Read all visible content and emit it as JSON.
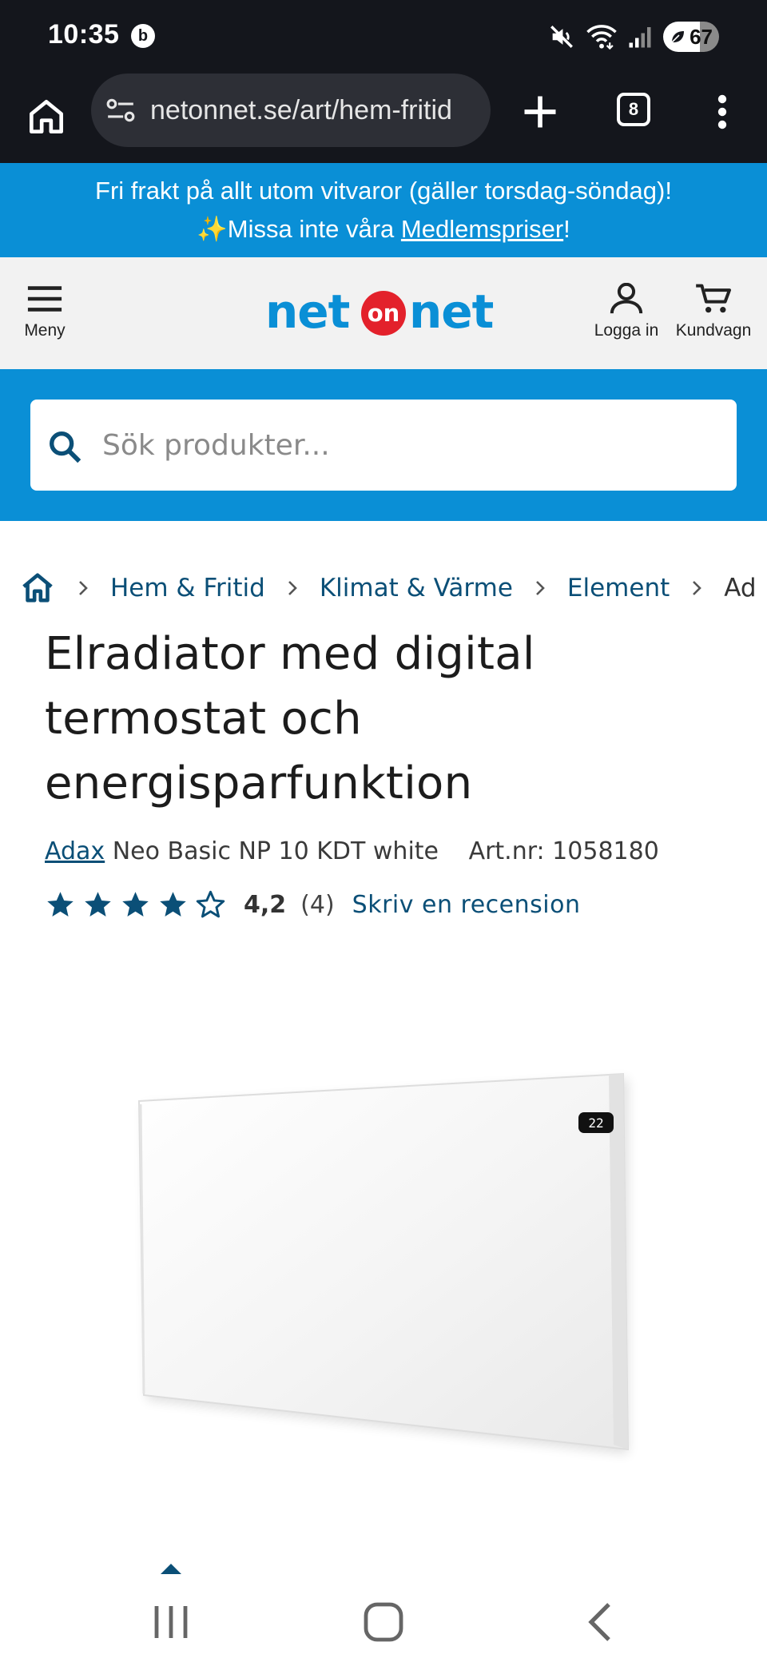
{
  "status_bar": {
    "time": "10:35",
    "notification_badge": "b",
    "battery": "67",
    "icons": [
      "mute-icon",
      "wifi-icon",
      "signal-icon",
      "battery-icon"
    ]
  },
  "browser": {
    "url": "netonnet.se/art/hem-fritid",
    "tab_count": "8",
    "icons": [
      "home-icon",
      "site-settings-icon",
      "new-tab-icon",
      "tab-switcher-icon",
      "more-icon"
    ]
  },
  "promo": {
    "line1": "Fri frakt på allt utom vitvaror (gäller torsdag-söndag)!",
    "line2_prefix": "✨Missa inte våra ",
    "line2_link": "Medlemspriser",
    "line2_suffix": "!"
  },
  "header": {
    "menu_label": "Meny",
    "logo_text": {
      "left": "net",
      "middle": "on",
      "right": "net"
    },
    "login_label": "Logga in",
    "cart_label": "Kundvagn"
  },
  "search": {
    "placeholder": "Sök produkter..."
  },
  "breadcrumb": {
    "items": [
      "Hem & Fritid",
      "Klimat & Värme",
      "Element",
      "Ad"
    ]
  },
  "product": {
    "title": "Elradiator med digital termostat och energisparfunktion",
    "brand": "Adax",
    "model": "Neo Basic NP 10 KDT white",
    "article_number": "Art.nr: 1058180",
    "rating_value": "4,2",
    "rating_stars": 4.2,
    "review_count": "(4)",
    "write_review": "Skriv en recension",
    "display_reading": "22"
  },
  "colors": {
    "brand_blue": "#0a8fd6",
    "link_blue": "#0b4f77",
    "logo_red": "#e3212b",
    "system_bar": "#14161c"
  }
}
